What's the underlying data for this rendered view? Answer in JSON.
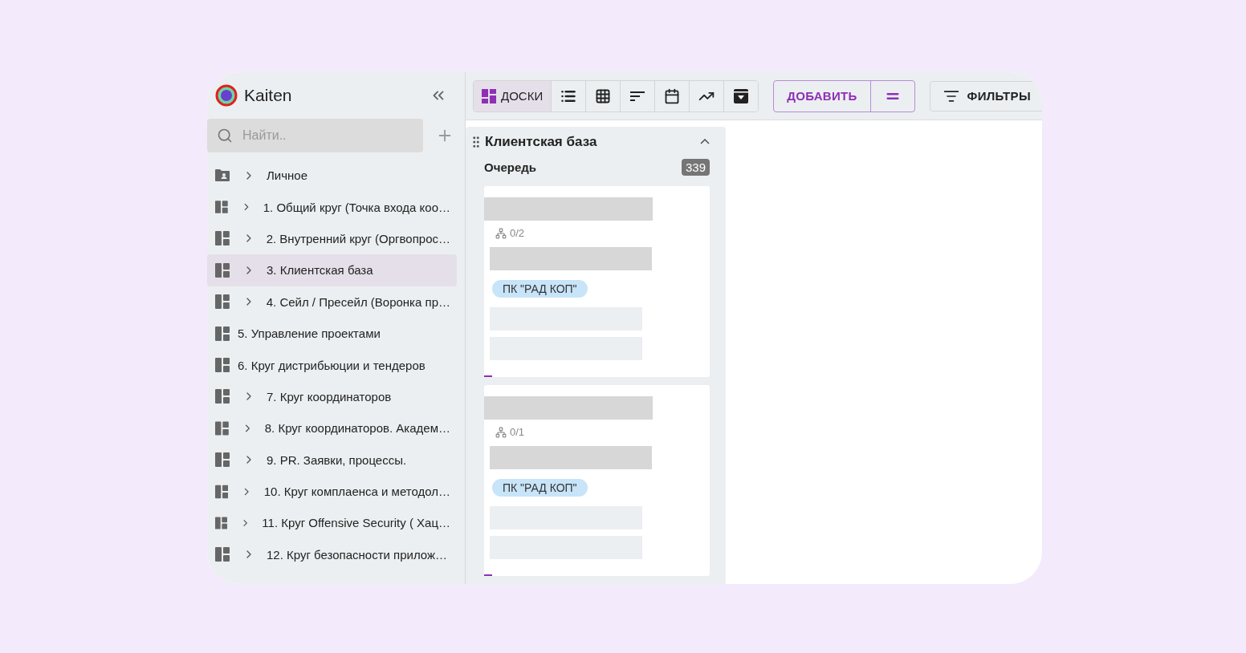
{
  "sidebar": {
    "brand": "Kaiten",
    "search": {
      "placeholder": "Найти.."
    },
    "items": [
      {
        "kind": "folder",
        "label": "Личное",
        "expandable": true,
        "selected": false
      },
      {
        "kind": "board",
        "label": "1. Общий круг (Точка входа коо…",
        "expandable": true,
        "selected": false
      },
      {
        "kind": "board",
        "label": "2. Внутренний круг (Оргвопрос…",
        "expandable": true,
        "selected": false
      },
      {
        "kind": "board",
        "label": "3. Клиентская база",
        "expandable": true,
        "selected": true
      },
      {
        "kind": "board",
        "label": "4. Сейл / Пресейл (Воронка пр…",
        "expandable": true,
        "selected": false
      },
      {
        "kind": "board",
        "label": "5. Управление проектами",
        "expandable": false,
        "selected": false
      },
      {
        "kind": "board",
        "label": "6. Круг дистрибьюции и тендеров",
        "expandable": false,
        "selected": false
      },
      {
        "kind": "board",
        "label": "7. Круг координаторов",
        "expandable": true,
        "selected": false
      },
      {
        "kind": "board",
        "label": "8. Круг координаторов. Академ…",
        "expandable": true,
        "selected": false
      },
      {
        "kind": "board",
        "label": "9. PR. Заявки, процессы.",
        "expandable": true,
        "selected": false
      },
      {
        "kind": "board",
        "label": "10. Круг комплаенса и методол…",
        "expandable": true,
        "selected": false
      },
      {
        "kind": "board",
        "label": "11. Круг Offensive Security ( Хац…",
        "expandable": true,
        "selected": false
      },
      {
        "kind": "board",
        "label": "12. Круг безопасности прилож…",
        "expandable": true,
        "selected": false
      }
    ]
  },
  "toolbar": {
    "views": [
      {
        "kind": "boards",
        "label": "ДОСКИ",
        "selected": true
      },
      {
        "kind": "list",
        "selected": false
      },
      {
        "kind": "table",
        "selected": false
      },
      {
        "kind": "sort",
        "selected": false
      },
      {
        "kind": "calendar",
        "selected": false
      },
      {
        "kind": "chart",
        "selected": false
      },
      {
        "kind": "archive",
        "selected": false
      }
    ],
    "add_button": "ДОБАВИТЬ",
    "filters_button": "ФИЛЬТРЫ"
  },
  "board": {
    "title": "Клиентская база",
    "expanded": true,
    "column": {
      "title": "Очередь",
      "count": "339"
    },
    "cards": [
      {
        "subtasks": "0/2",
        "tag": "ПК \"РАД КОП\""
      },
      {
        "subtasks": "0/1",
        "tag": "ПК \"РАД КОП\""
      }
    ]
  }
}
